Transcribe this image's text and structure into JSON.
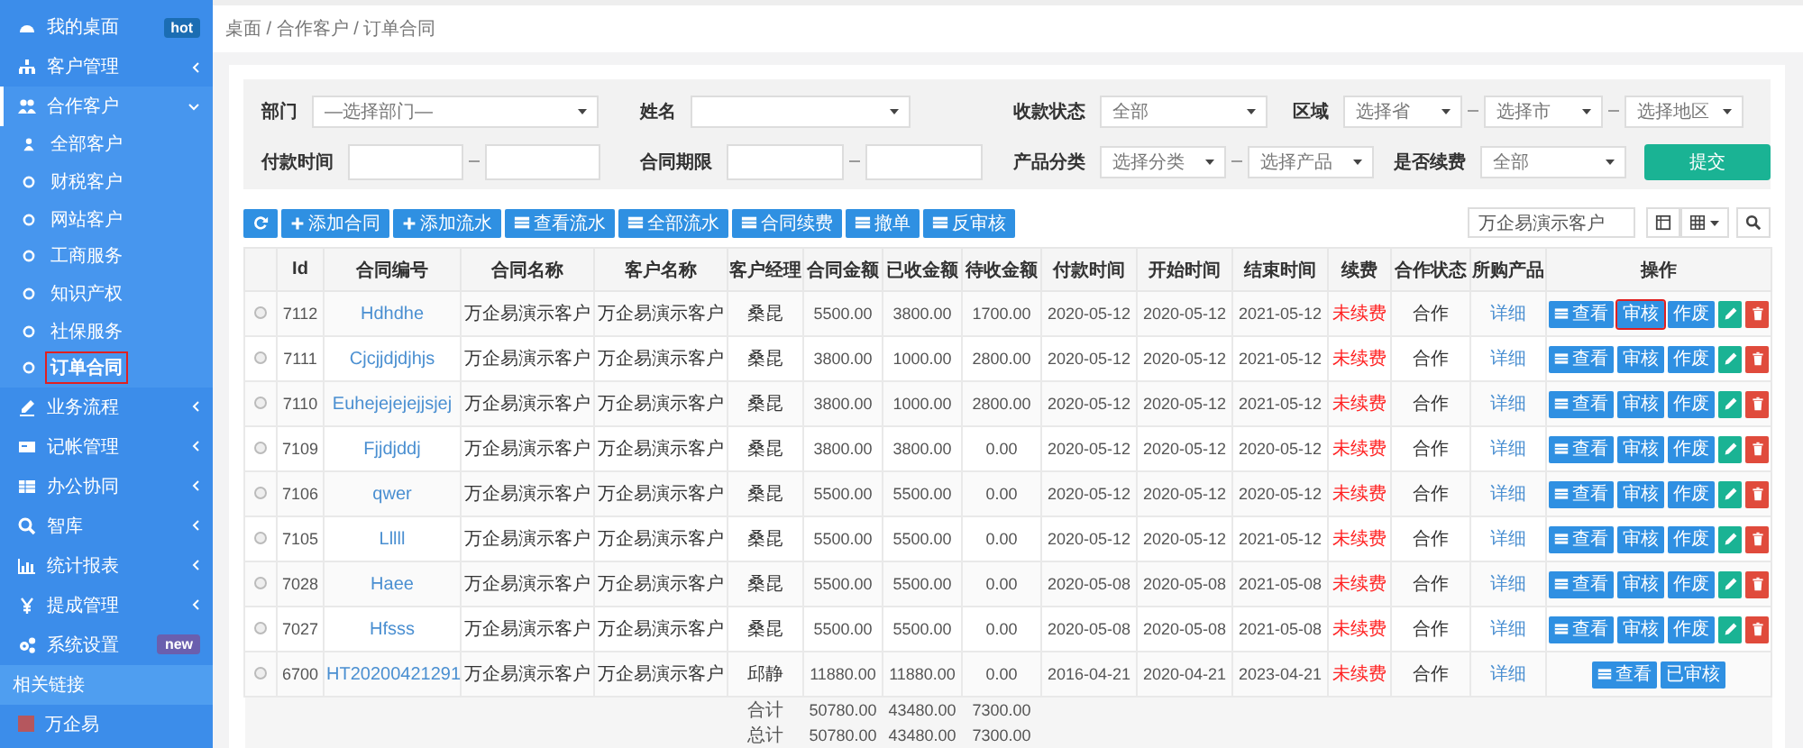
{
  "sidebar": {
    "items": [
      {
        "kind": "item",
        "label": "我的桌面",
        "selected": false,
        "badge": {
          "text": "hot",
          "color": "#1b6db3"
        }
      },
      {
        "kind": "group",
        "label": "客户管理",
        "selected": false,
        "expanded": false
      },
      {
        "kind": "group",
        "label": "合作客户",
        "selected": true,
        "expanded": true,
        "children": [
          {
            "label": "全部客户",
            "selected": false,
            "annotated": false
          },
          {
            "label": "财税客户",
            "selected": false,
            "annotated": false
          },
          {
            "label": "网站客户",
            "selected": false,
            "annotated": false
          },
          {
            "label": "工商服务",
            "selected": false,
            "annotated": false
          },
          {
            "label": "知识产权",
            "selected": false,
            "annotated": false
          },
          {
            "label": "社保服务",
            "selected": false,
            "annotated": false
          },
          {
            "label": "订单合同",
            "selected": true,
            "annotated": true
          }
        ]
      },
      {
        "kind": "group",
        "label": "业务流程",
        "selected": false,
        "expanded": false
      },
      {
        "kind": "group",
        "label": "记帐管理",
        "selected": false,
        "expanded": false
      },
      {
        "kind": "group",
        "label": "办公协同",
        "selected": false,
        "expanded": false
      },
      {
        "kind": "group",
        "label": "智库",
        "selected": false,
        "expanded": false
      },
      {
        "kind": "group",
        "label": "统计报表",
        "selected": false,
        "expanded": false
      },
      {
        "kind": "group",
        "label": "提成管理",
        "selected": false,
        "expanded": false
      },
      {
        "kind": "item",
        "label": "系统设置",
        "selected": false,
        "badge": {
          "text": "new",
          "color": "#6a5fae"
        }
      },
      {
        "kind": "section",
        "label": "相关链接"
      },
      {
        "kind": "link",
        "label": "万企易"
      }
    ]
  },
  "breadcrumb": "桌面 / 合作客户 / 订单合同",
  "filters": [
    [
      {
        "label": "部门",
        "fields": [
          {
            "kind": "select",
            "value": "—选择部门—"
          }
        ]
      },
      {
        "label": "姓名",
        "fields": [
          {
            "kind": "select"
          }
        ]
      },
      {
        "label": "收款状态",
        "fields": [
          {
            "kind": "select",
            "value": "全部"
          }
        ]
      },
      {
        "label": "区域",
        "fields": [
          {
            "kind": "select",
            "value": "选择省"
          },
          {
            "kind": "select",
            "value": "选择市"
          },
          {
            "kind": "select",
            "value": "选择地区"
          }
        ]
      }
    ],
    [
      {
        "label": "付款时间",
        "fields": [
          {
            "kind": "input"
          },
          {
            "kind": "input"
          }
        ]
      },
      {
        "label": "合同期限",
        "fields": [
          {
            "kind": "input"
          },
          {
            "kind": "input"
          }
        ]
      },
      {
        "label": "产品分类",
        "fields": [
          {
            "kind": "select",
            "value": "选择分类"
          },
          {
            "kind": "select",
            "value": "选择产品"
          }
        ]
      },
      {
        "label": "是否续费",
        "fields": [
          {
            "kind": "select",
            "value": "全部"
          }
        ]
      },
      {
        "fields": [
          {
            "kind": "button",
            "label": "提交"
          }
        ]
      }
    ]
  ],
  "toolbar": {
    "buttons": [
      {
        "kind": "refresh"
      },
      {
        "kind": "add",
        "label": "添加合同"
      },
      {
        "kind": "add",
        "label": "添加流水"
      },
      {
        "kind": "list",
        "label": "查看流水"
      },
      {
        "kind": "list",
        "label": "全部流水"
      },
      {
        "kind": "list",
        "label": "合同续费"
      },
      {
        "kind": "list",
        "label": "撤单"
      },
      {
        "kind": "list",
        "label": "反审核"
      }
    ],
    "search": {
      "value": "万企易演示客户"
    }
  },
  "table": {
    "columns": [
      "Id",
      "合同编号",
      "合同名称",
      "客户名称",
      "客户经理",
      "合同金额",
      "已收金额",
      "待收金额",
      "付款时间",
      "开始时间",
      "结束时间",
      "续费",
      "合作状态",
      "所购产品",
      "操作"
    ],
    "rows": [
      {
        "selected": false,
        "cells": [
          "7112",
          "Hdhdhe",
          "万企易演示客户",
          "万企易演示客户",
          "桑昆",
          "5500.00",
          "3800.00",
          "1700.00",
          "2020-05-12",
          "2020-05-12",
          "2021-05-12",
          "未续费",
          "合作",
          "详细"
        ],
        "actions": [
          {
            "kind": "view",
            "label": "查看",
            "annotated": false
          },
          {
            "kind": "text",
            "label": "审核",
            "annotated": true
          },
          {
            "kind": "text",
            "label": "作废",
            "annotated": false
          },
          {
            "kind": "edit",
            "annotated": false
          },
          {
            "kind": "delete",
            "annotated": false
          }
        ]
      },
      {
        "selected": false,
        "cells": [
          "7111",
          "Cjcjjdjdjhjs",
          "万企易演示客户",
          "万企易演示客户",
          "桑昆",
          "3800.00",
          "1000.00",
          "2800.00",
          "2020-05-12",
          "2020-05-12",
          "2021-05-12",
          "未续费",
          "合作",
          "详细"
        ],
        "actions": [
          {
            "kind": "view",
            "label": "查看",
            "annotated": false
          },
          {
            "kind": "text",
            "label": "审核",
            "annotated": false
          },
          {
            "kind": "text",
            "label": "作废",
            "annotated": false
          },
          {
            "kind": "edit",
            "annotated": false
          },
          {
            "kind": "delete",
            "annotated": false
          }
        ]
      },
      {
        "selected": false,
        "cells": [
          "7110",
          "Euhejejejejjsjej",
          "万企易演示客户",
          "万企易演示客户",
          "桑昆",
          "3800.00",
          "1000.00",
          "2800.00",
          "2020-05-12",
          "2020-05-12",
          "2021-05-12",
          "未续费",
          "合作",
          "详细"
        ],
        "actions": [
          {
            "kind": "view",
            "label": "查看",
            "annotated": false
          },
          {
            "kind": "text",
            "label": "审核",
            "annotated": false
          },
          {
            "kind": "text",
            "label": "作废",
            "annotated": false
          },
          {
            "kind": "edit",
            "annotated": false
          },
          {
            "kind": "delete",
            "annotated": false
          }
        ]
      },
      {
        "selected": false,
        "cells": [
          "7109",
          "Fjjdjddj",
          "万企易演示客户",
          "万企易演示客户",
          "桑昆",
          "3800.00",
          "3800.00",
          "0.00",
          "2020-05-12",
          "2020-05-12",
          "2020-05-12",
          "未续费",
          "合作",
          "详细"
        ],
        "actions": [
          {
            "kind": "view",
            "label": "查看",
            "annotated": false
          },
          {
            "kind": "text",
            "label": "审核",
            "annotated": false
          },
          {
            "kind": "text",
            "label": "作废",
            "annotated": false
          },
          {
            "kind": "edit",
            "annotated": false
          },
          {
            "kind": "delete",
            "annotated": false
          }
        ]
      },
      {
        "selected": false,
        "cells": [
          "7106",
          "qwer",
          "万企易演示客户",
          "万企易演示客户",
          "桑昆",
          "5500.00",
          "5500.00",
          "0.00",
          "2020-05-12",
          "2020-05-12",
          "2020-05-12",
          "未续费",
          "合作",
          "详细"
        ],
        "actions": [
          {
            "kind": "view",
            "label": "查看",
            "annotated": false
          },
          {
            "kind": "text",
            "label": "审核",
            "annotated": false
          },
          {
            "kind": "text",
            "label": "作废",
            "annotated": false
          },
          {
            "kind": "edit",
            "annotated": false
          },
          {
            "kind": "delete",
            "annotated": false
          }
        ]
      },
      {
        "selected": false,
        "cells": [
          "7105",
          "Lllll",
          "万企易演示客户",
          "万企易演示客户",
          "桑昆",
          "5500.00",
          "5500.00",
          "0.00",
          "2020-05-12",
          "2020-05-12",
          "2021-05-12",
          "未续费",
          "合作",
          "详细"
        ],
        "actions": [
          {
            "kind": "view",
            "label": "查看",
            "annotated": false
          },
          {
            "kind": "text",
            "label": "审核",
            "annotated": false
          },
          {
            "kind": "text",
            "label": "作废",
            "annotated": false
          },
          {
            "kind": "edit",
            "annotated": false
          },
          {
            "kind": "delete",
            "annotated": false
          }
        ]
      },
      {
        "selected": false,
        "cells": [
          "7028",
          "Haee",
          "万企易演示客户",
          "万企易演示客户",
          "桑昆",
          "5500.00",
          "5500.00",
          "0.00",
          "2020-05-08",
          "2020-05-08",
          "2021-05-08",
          "未续费",
          "合作",
          "详细"
        ],
        "actions": [
          {
            "kind": "view",
            "label": "查看",
            "annotated": false
          },
          {
            "kind": "text",
            "label": "审核",
            "annotated": false
          },
          {
            "kind": "text",
            "label": "作废",
            "annotated": false
          },
          {
            "kind": "edit",
            "annotated": false
          },
          {
            "kind": "delete",
            "annotated": false
          }
        ]
      },
      {
        "selected": false,
        "cells": [
          "7027",
          "Hfsss",
          "万企易演示客户",
          "万企易演示客户",
          "桑昆",
          "5500.00",
          "5500.00",
          "0.00",
          "2020-05-08",
          "2020-05-08",
          "2021-05-08",
          "未续费",
          "合作",
          "详细"
        ],
        "actions": [
          {
            "kind": "view",
            "label": "查看",
            "annotated": false
          },
          {
            "kind": "text",
            "label": "审核",
            "annotated": false
          },
          {
            "kind": "text",
            "label": "作废",
            "annotated": false
          },
          {
            "kind": "edit",
            "annotated": false
          },
          {
            "kind": "delete",
            "annotated": false
          }
        ]
      },
      {
        "selected": false,
        "cells": [
          "6700",
          "HT20200421291",
          "万企易演示客户",
          "万企易演示客户",
          "邱静",
          "11880.00",
          "11880.00",
          "0.00",
          "2016-04-21",
          "2020-04-21",
          "2023-04-21",
          "未续费",
          "合作",
          "详细"
        ],
        "actions": [
          {
            "kind": "view",
            "label": "查看",
            "annotated": false
          },
          {
            "kind": "text",
            "label": "已审核",
            "annotated": false
          }
        ]
      }
    ],
    "totals": [
      {
        "label": "合计",
        "values": [
          "50780.00",
          "43480.00",
          "7300.00"
        ]
      },
      {
        "label": "总计",
        "values": [
          "50780.00",
          "43480.00",
          "7300.00"
        ]
      }
    ]
  }
}
